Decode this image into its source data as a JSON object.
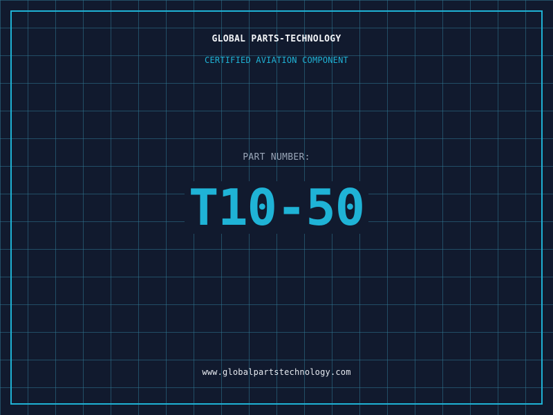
{
  "header": {
    "company_name": "GLOBAL PARTS-TECHNOLOGY",
    "subtitle": "CERTIFIED AVIATION COMPONENT"
  },
  "part": {
    "label": "PART NUMBER:",
    "number": "T10-50"
  },
  "footer": {
    "website": "www.globalpartstechnology.com"
  },
  "colors": {
    "background": "#111a2e",
    "grid": "#307894",
    "accent": "#1fb3d6",
    "title_text": "#f2f4f7",
    "label_text": "#9aa6b8"
  }
}
